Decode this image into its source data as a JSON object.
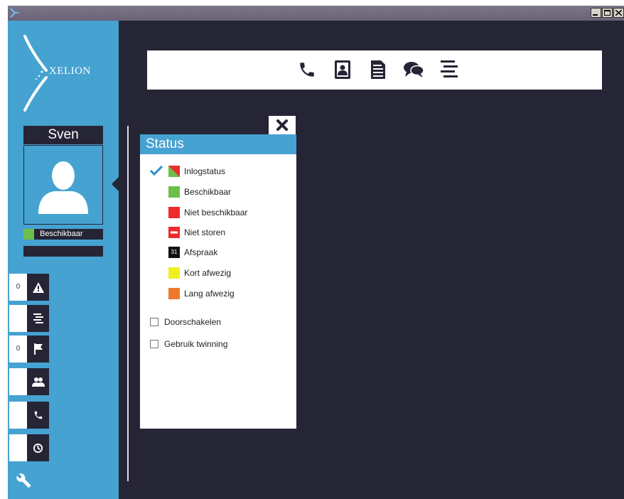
{
  "logo": {
    "text": "XELION"
  },
  "user": {
    "name": "Sven",
    "status_label": "Beschikbaar",
    "status_color": "#6cbf4b"
  },
  "sidebar": {
    "tiles": [
      {
        "name": "alerts",
        "count": "0",
        "icon": "warning-icon"
      },
      {
        "name": "list",
        "count": "",
        "icon": "list-icon"
      },
      {
        "name": "flags",
        "count": "0",
        "icon": "flag-icon"
      },
      {
        "name": "contacts",
        "count": "",
        "icon": "users-icon"
      },
      {
        "name": "calls",
        "count": "",
        "icon": "phone-icon"
      },
      {
        "name": "history",
        "count": "",
        "icon": "history-icon"
      }
    ],
    "settings_icon": "wrench-icon"
  },
  "toolbar": {
    "icons": [
      "phone-icon",
      "addressbook-icon",
      "document-icon",
      "chat-icon",
      "menu-icon"
    ]
  },
  "status_panel": {
    "title": "Status",
    "options": [
      {
        "label": "Inlogstatus",
        "color": "#e8302c",
        "icon": "login-status-icon",
        "selected": true
      },
      {
        "label": "Beschikbaar",
        "color": "#6cbf4b"
      },
      {
        "label": "Niet beschikbaar",
        "color": "#ee2b2b"
      },
      {
        "label": "Niet storen",
        "color": "#ee2b2b",
        "icon": "do-not-disturb-icon"
      },
      {
        "label": "Afspraak",
        "color": "#111111",
        "icon": "calendar-icon",
        "badge": "31"
      },
      {
        "label": "Kort afwezig",
        "color": "#f0f021"
      },
      {
        "label": "Lang afwezig",
        "color": "#f07a2c"
      }
    ],
    "checkboxes": [
      {
        "label": "Doorschakelen",
        "checked": false
      },
      {
        "label": "Gebruik twinning",
        "checked": false
      }
    ]
  },
  "colors": {
    "accent": "#45a2d1",
    "background": "#262536",
    "check": "#2b8fd0"
  }
}
